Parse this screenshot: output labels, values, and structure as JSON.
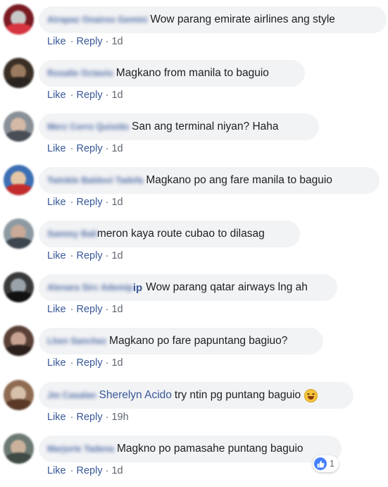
{
  "actions": {
    "like": "Like",
    "reply": "Reply",
    "separator": "·"
  },
  "comments": [
    {
      "author": "Atrapaz Onairos Gemini",
      "text": "Wow parang emirate airlines ang style",
      "time": "1d",
      "avatar_colors": [
        "#7a1a22",
        "#c8c8c8",
        "#d6343f"
      ]
    },
    {
      "author": "Rosalie Octavio",
      "text": "Magkano from manila to baguio",
      "time": "1d",
      "avatar_colors": [
        "#3b2f25",
        "#9b7b5f",
        "#2a2420"
      ]
    },
    {
      "author": "Merz Corro Quisido",
      "text": "San ang terminal niyan? Haha",
      "time": "1d",
      "avatar_colors": [
        "#8a9098",
        "#d3b9a6",
        "#4a4f57"
      ]
    },
    {
      "author": "Twinkle Baldovi Tadefa",
      "text": "Magkano po ang fare manila to baguio",
      "time": "1d",
      "avatar_colors": [
        "#3c6fb4",
        "#e3c6a6",
        "#c22c2c"
      ]
    },
    {
      "author": "Sammy Bali",
      "text": "meron kaya route cubao to dilasag",
      "time": "1d",
      "avatar_colors": [
        "#8e9aa2",
        "#c9a998",
        "#3d454e"
      ]
    },
    {
      "author": "Alenara Sirc Ademip",
      "name_tail": "ip",
      "text": "Wow parang qatar airways lng ah",
      "time": "1d",
      "avatar_colors": [
        "#3a3a3a",
        "#9aa3aa",
        "#111111"
      ]
    },
    {
      "author": "Lhen Sanchez",
      "text": "Magkano po fare papuntang bagiuo?",
      "time": "1d",
      "avatar_colors": [
        "#5a4036",
        "#c7a293",
        "#2b1f1b"
      ]
    },
    {
      "author": "Jm Casalan",
      "tag": "Sherelyn Acido",
      "text": "try ntin pg puntang baguio",
      "emoji": "grinning-face",
      "time": "19h",
      "avatar_colors": [
        "#8f6b51",
        "#d7c1ad",
        "#5a3a27"
      ]
    },
    {
      "author": "Marjorie Tadena",
      "text": "Magkno po pamasahe puntang baguio",
      "time": "1d",
      "avatar_colors": [
        "#6d7a73",
        "#c9b19c",
        "#3f4a44"
      ]
    }
  ],
  "reaction": {
    "icon": "thumbs-up-icon",
    "count": "1",
    "color": "#4680ff"
  }
}
